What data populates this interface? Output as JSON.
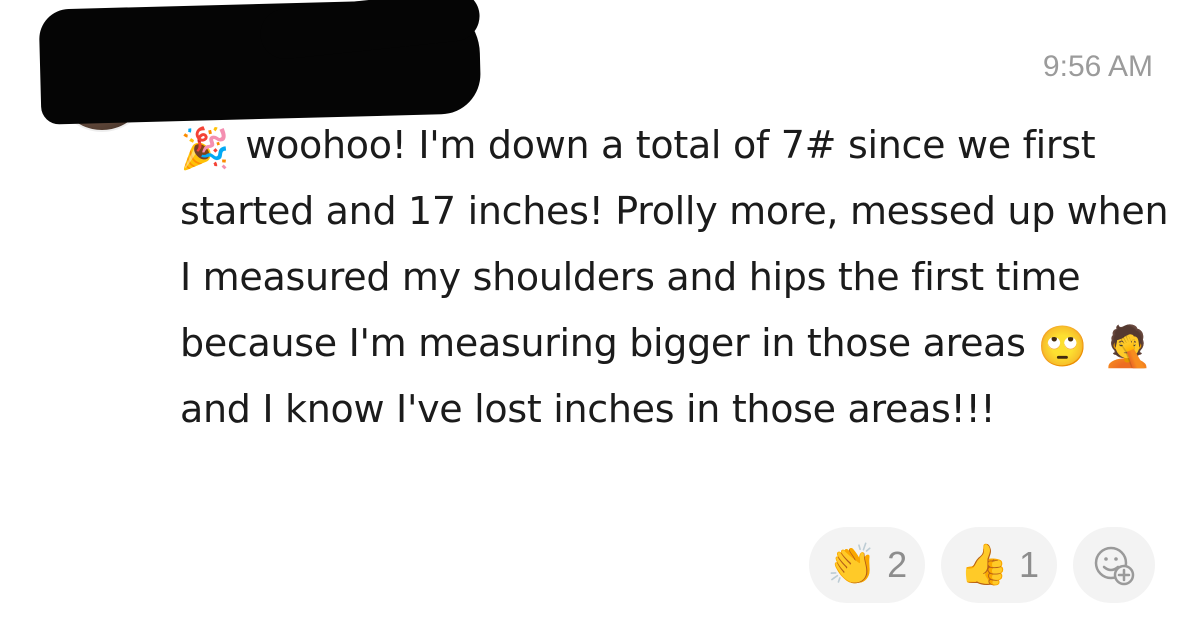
{
  "timestamp": "9:56 AM",
  "message": {
    "leading_emoji": "🎉",
    "text_part1": "woohoo! I'm down a total of 7# since we first started and 17 inches! Prolly more, messed up when I measured my shoulders and hips the first time because I'm measuring bigger in those areas",
    "emoji_eyeroll": "🙄",
    "emoji_facepalm": "🤦",
    "text_part2": "and I know I've lost inches in those areas!!!"
  },
  "reactions": [
    {
      "icon": "clapping-hands-icon",
      "emoji": "👏",
      "count": "2"
    },
    {
      "icon": "thumbs-up-icon",
      "emoji": "👍",
      "count": "1"
    }
  ],
  "add_reaction": {
    "icon": "add-reaction-icon"
  }
}
